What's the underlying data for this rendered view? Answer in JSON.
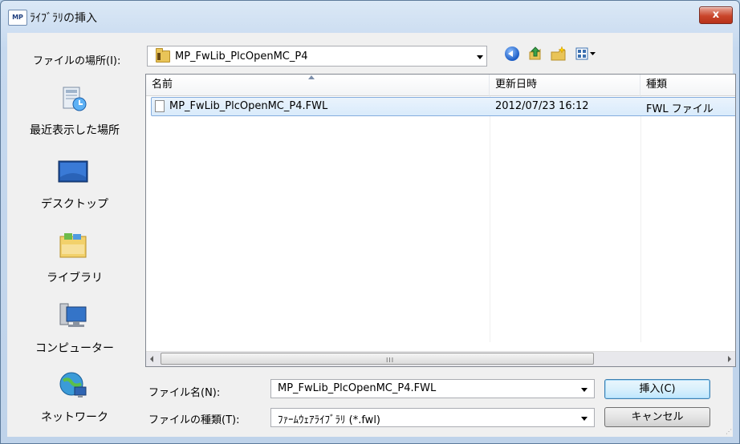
{
  "window": {
    "app_icon_text": "MP",
    "title": "ﾗｲﾌﾞﾗﾘの挿入",
    "close_label": "x"
  },
  "lookin": {
    "label": "ファイルの場所(I):",
    "value": "MP_FwLib_PlcOpenMC_P4"
  },
  "places": [
    {
      "label": "最近表示した場所",
      "icon": "recent-places-icon"
    },
    {
      "label": "デスクトップ",
      "icon": "desktop-icon"
    },
    {
      "label": "ライブラリ",
      "icon": "libraries-icon"
    },
    {
      "label": "コンピューター",
      "icon": "computer-icon"
    },
    {
      "label": "ネットワーク",
      "icon": "network-icon"
    }
  ],
  "columns": {
    "name": "名前",
    "date": "更新日時",
    "type": "種類"
  },
  "files": [
    {
      "name": "MP_FwLib_PlcOpenMC_P4.FWL",
      "date": "2012/07/23 16:12",
      "type": "FWL ファイル"
    }
  ],
  "scrollbar": {
    "grip": "III"
  },
  "filename": {
    "label": "ファイル名(N):",
    "value": "MP_FwLib_PlcOpenMC_P4.FWL"
  },
  "filetype": {
    "label": "ファイルの種類(T):",
    "value": "ﾌｧｰﾑｳｪｱﾗｲﾌﾞﾗﾘ (*.fwl)"
  },
  "buttons": {
    "insert": "挿入(C)",
    "cancel": "キャンセル"
  }
}
